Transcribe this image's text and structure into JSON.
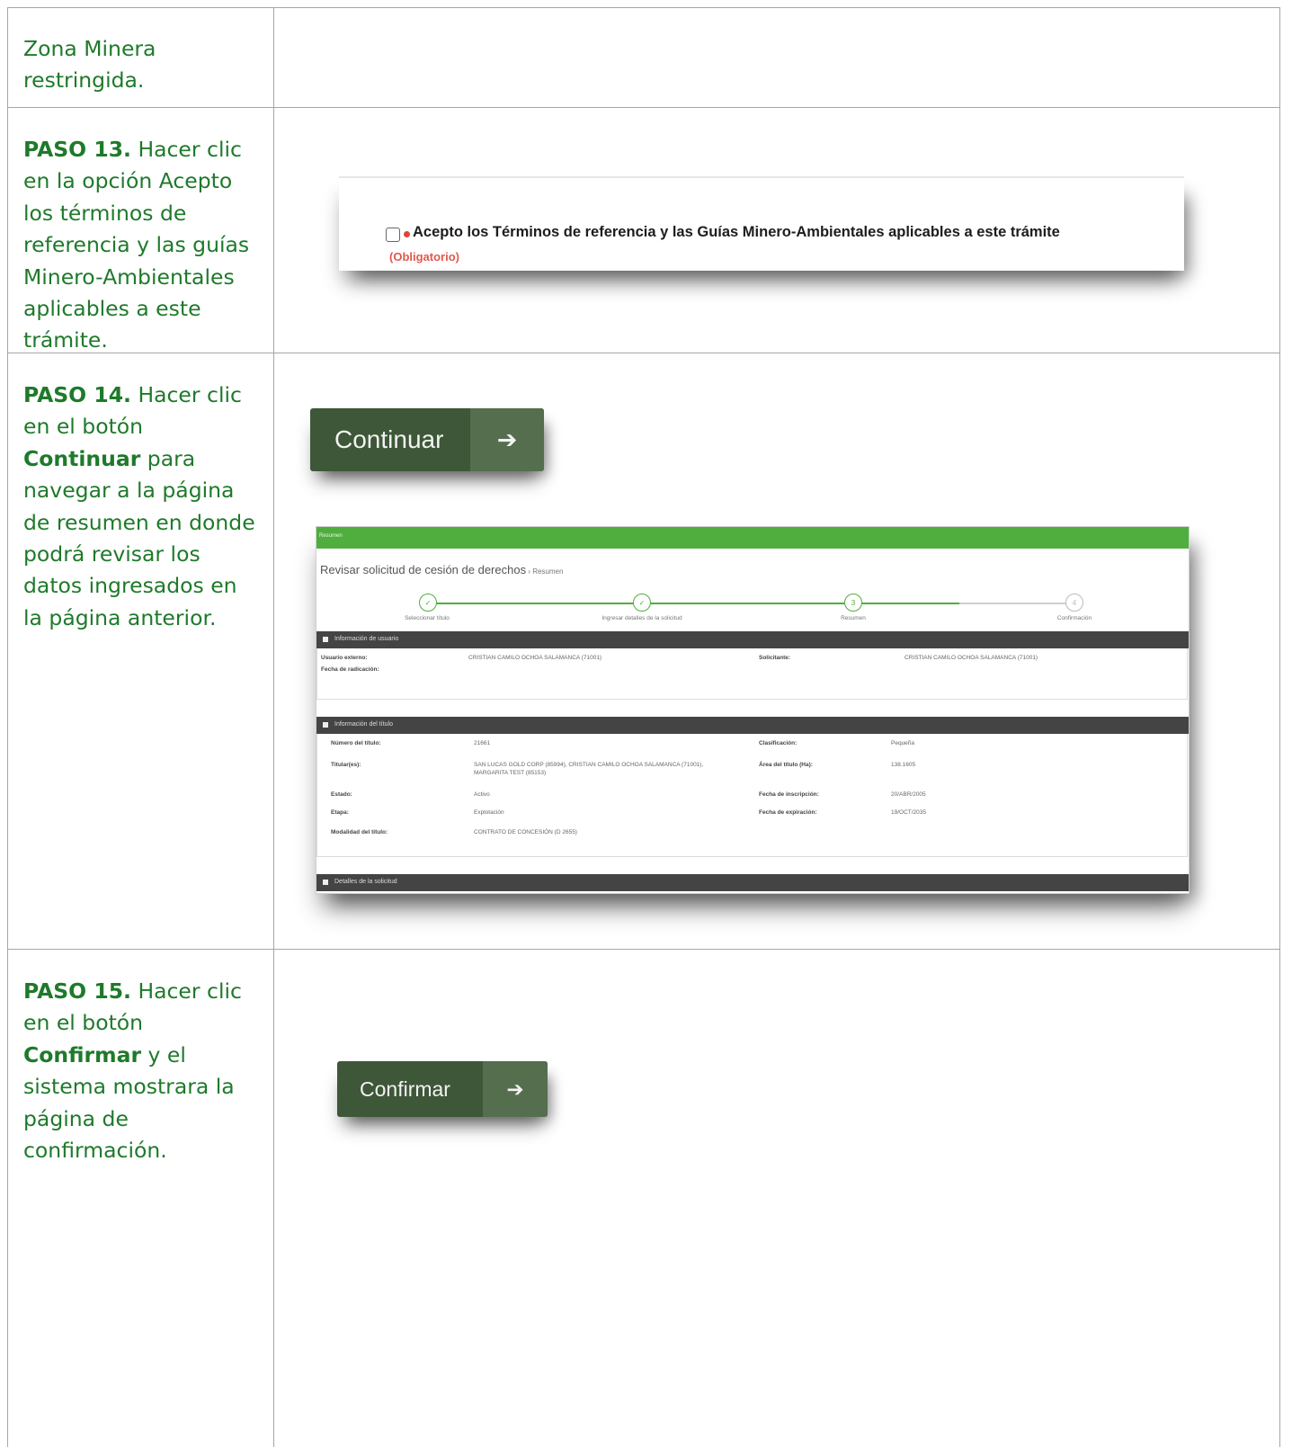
{
  "rows": {
    "zona": {
      "text": "Zona Minera restringida."
    },
    "paso13": {
      "step": "PASO 13.",
      "text": " Hacer clic en la opción Acepto los términos de referencia y las guías Minero-Ambientales aplicables a este trámite."
    },
    "paso14": {
      "step": "PASO 14.",
      "text1": " Hacer clic en el botón ",
      "bold": "Continuar",
      "text2": " para navegar a la página de resumen en donde podrá revisar los datos ingresados en la página anterior."
    },
    "paso15": {
      "step": "PASO 15.",
      "text1": " Hacer clic en el botón ",
      "bold": "Confirmar",
      "text2": " y el sistema mostrara la página de confirmación."
    }
  },
  "checkbox": {
    "label": "Acepto los Términos de referencia y las Guías Minero-Ambientales aplicables a este trámite",
    "required": "(Obligatorio)",
    "checked": false
  },
  "buttons": {
    "continuar": {
      "label": "Continuar",
      "icon": "arrow-right-icon",
      "arrow": "➔"
    },
    "confirmar": {
      "label": "Confirmar",
      "icon": "arrow-right-icon",
      "arrow": "➔"
    }
  },
  "summary": {
    "header": "Resumen",
    "title": "Revisar solicitud de cesión de derechos",
    "crumb": " › Resumen",
    "steps": [
      {
        "label": "Seleccionar título",
        "mark": "✓",
        "state": "done"
      },
      {
        "label": "Ingresar detalles de la solicitud",
        "mark": "✓",
        "state": "done"
      },
      {
        "label": "Resumen",
        "mark": "3",
        "state": "current"
      },
      {
        "label": "Confirmación",
        "mark": "4",
        "state": "pending"
      }
    ],
    "user_section": {
      "title": "Información de usuario",
      "external_user_label": "Usuario externo:",
      "external_user_value": "CRISTIAN CAMILO OCHOA SALAMANCA (71001)",
      "applicant_label": "Solicitante:",
      "applicant_value": "CRISTIAN CAMILO OCHOA SALAMANCA (71001)",
      "date_label": "Fecha de radicación:"
    },
    "title_section": {
      "title": "Información del título",
      "fields": {
        "numero_label": "Número del título:",
        "numero_value": "21661",
        "clasif_label": "Clasificación:",
        "clasif_value": "Pequeña",
        "titular_label": "Titular(es):",
        "titular_value1": "SAN LUCAS GOLD CORP (85994), CRISTIAN CAMILO OCHOA SALAMANCA (71001),",
        "titular_value2": "MARGARITA TEST (85153)",
        "area_label": "Área del título (Ha):",
        "area_value": "138.1605",
        "estado_label": "Estado:",
        "estado_value": "Activo",
        "inscrip_label": "Fecha de inscripción:",
        "inscrip_value": "20/ABR/2005",
        "etapa_label": "Etapa:",
        "etapa_value": "Explotación",
        "expir_label": "Fecha de expiración:",
        "expir_value": "19/OCT/2035",
        "modal_label": "Modalidad del título:",
        "modal_value": "CONTRATO DE CONCESIÓN (D 2655)"
      }
    },
    "details_section": {
      "title": "Detalles de la solicitud"
    }
  }
}
